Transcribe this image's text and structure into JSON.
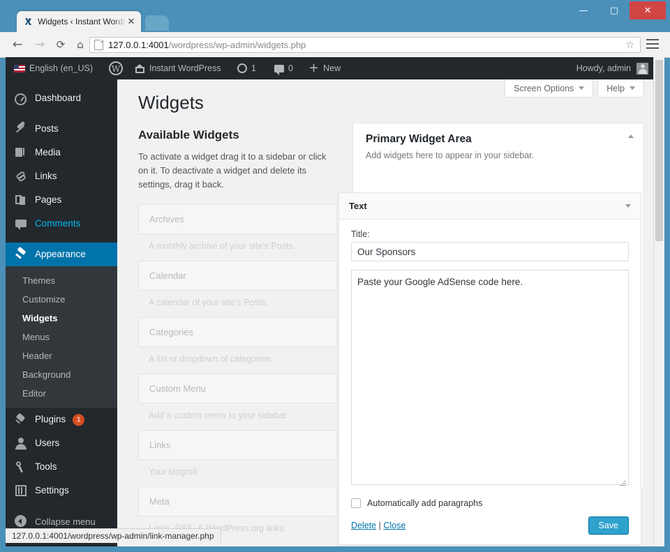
{
  "browser": {
    "tab_title": "Widgets ‹ Instant WordPre",
    "tab_close": "✕",
    "url_host": "127.0.0.1:4001",
    "url_path": "/wordpress/wp-admin/widgets.php",
    "back_icon": "←",
    "forward_icon": "→",
    "reload_icon": "⟳",
    "home_icon": "⌂",
    "star_icon": "☆",
    "minimize": "—",
    "maximize": "▢",
    "close": "✕",
    "status_url": "127.0.0.1:4001/wordpress/wp-admin/link-manager.php"
  },
  "adminbar": {
    "language": "English (en_US)",
    "site_name": "Instant WordPress",
    "updates_count": "1",
    "comments_count": "0",
    "new_label": "New",
    "howdy": "Howdy, admin"
  },
  "sidebar": {
    "items": [
      {
        "label": "Dashboard",
        "icon": "dashboard-icon",
        "state": "default"
      },
      {
        "label": "Posts",
        "icon": "pin-icon",
        "state": "default"
      },
      {
        "label": "Media",
        "icon": "media-icon",
        "state": "default"
      },
      {
        "label": "Links",
        "icon": "link-icon",
        "state": "default"
      },
      {
        "label": "Pages",
        "icon": "pages-icon",
        "state": "default"
      },
      {
        "label": "Comments",
        "icon": "comment-icon",
        "state": "hovered"
      },
      {
        "label": "Appearance",
        "icon": "brush-icon",
        "state": "current"
      },
      {
        "label": "Plugins",
        "icon": "plugin-icon",
        "state": "default",
        "badge": "1"
      },
      {
        "label": "Users",
        "icon": "user-icon",
        "state": "default"
      },
      {
        "label": "Tools",
        "icon": "wrench-icon",
        "state": "default"
      },
      {
        "label": "Settings",
        "icon": "settings-icon",
        "state": "default"
      }
    ],
    "submenu": [
      {
        "label": "Themes",
        "active": false
      },
      {
        "label": "Customize",
        "active": false
      },
      {
        "label": "Widgets",
        "active": true
      },
      {
        "label": "Menus",
        "active": false
      },
      {
        "label": "Header",
        "active": false
      },
      {
        "label": "Background",
        "active": false
      },
      {
        "label": "Editor",
        "active": false
      }
    ],
    "collapse_label": "Collapse menu",
    "accent_color": "#0073aa",
    "badge_color": "#d54e21"
  },
  "screen_meta": {
    "screen_options": "Screen Options",
    "help": "Help"
  },
  "main": {
    "page_title": "Widgets",
    "available_heading": "Available Widgets",
    "available_desc": "To activate a widget drag it to a sidebar or click on it. To deactivate a widget and delete its settings, drag it back.",
    "available_widgets": [
      {
        "name": "Archives",
        "desc": "A monthly archive of your site’s Posts."
      },
      {
        "name": "Calendar",
        "desc": "A calendar of your site’s Posts."
      },
      {
        "name": "Categories",
        "desc": "A list or dropdown of categories."
      },
      {
        "name": "Custom Menu",
        "desc": "Add a custom menu to your sidebar."
      },
      {
        "name": "Links",
        "desc": "Your blogroll"
      },
      {
        "name": "Meta",
        "desc": "Login, RSS, & WordPress.org links."
      }
    ]
  },
  "sidebar_area": {
    "title": "Primary Widget Area",
    "description": "Add widgets here to appear in your sidebar."
  },
  "widget_form": {
    "header": "Text",
    "title_label": "Title:",
    "title_value": "Our Sponsors",
    "content_value": "Paste your Google AdSense code here.",
    "autop_label": "Automatically add paragraphs",
    "autop_checked": false,
    "delete_label": "Delete",
    "separator": "|",
    "close_label": "Close",
    "save_label": "Save",
    "save_color": "#2ea2cc"
  }
}
